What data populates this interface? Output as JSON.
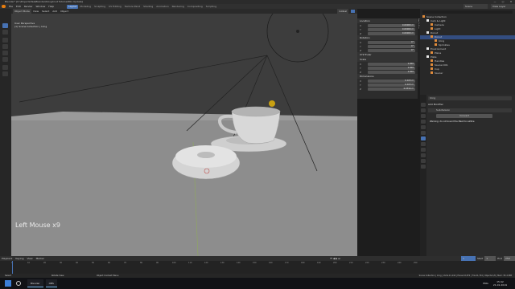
{
  "window": {
    "title": "Blender* [D:\\Projects\\Tea\\Blender\\Doughnut Tutorial\\Mix Update]",
    "controls": [
      "—",
      "▢",
      "✕"
    ]
  },
  "menu": [
    "File",
    "Edit",
    "Render",
    "Window",
    "Help"
  ],
  "workspaces": [
    "Layout",
    "Modeling",
    "Sculpting",
    "UV Editing",
    "Texture Paint",
    "Shading",
    "Animation",
    "Rendering",
    "Compositing",
    "Scripting"
  ],
  "active_workspace": "Layout",
  "top_right": {
    "scene": "Scene",
    "view_layer": "View Layer"
  },
  "viewport_header": {
    "mode": "Object Mode",
    "menus": [
      "View",
      "Select",
      "Add",
      "Object"
    ],
    "shading": "Global"
  },
  "viewport_info": {
    "line1": "User Perspective",
    "line2": "(1) Scene Collection | Icing"
  },
  "overlay": "Left Mouse x9",
  "npanel": {
    "sections": [
      {
        "title": "Location",
        "rows": [
          [
            "X",
            "0.00000 m"
          ],
          [
            "Y",
            "0.00000 m"
          ],
          [
            "Z",
            "0.00000 m"
          ]
        ]
      },
      {
        "title": "Rotation",
        "rows": [
          [
            "X",
            "0°"
          ],
          [
            "Y",
            "0°"
          ],
          [
            "Z",
            "0°"
          ]
        ]
      },
      {
        "title": "XYZ Euler",
        "rows": []
      },
      {
        "title": "Scale",
        "rows": [
          [
            "X",
            "1.000"
          ],
          [
            "Y",
            "1.000"
          ],
          [
            "Z",
            "1.000"
          ]
        ]
      },
      {
        "title": "Dimensions",
        "rows": [
          [
            "X",
            "0.103 m"
          ],
          [
            "Y",
            "0.103 m"
          ],
          [
            "Z",
            "0.0394 m"
          ]
        ]
      }
    ],
    "tabs": [
      "Item",
      "Tool",
      "View"
    ]
  },
  "outliner": {
    "rows": [
      {
        "label": "Scene Collection",
        "indent": 0,
        "selected": false
      },
      {
        "label": "Cam & Light",
        "indent": 1,
        "selected": false
      },
      {
        "label": "Camera",
        "indent": 2,
        "selected": false
      },
      {
        "label": "Light",
        "indent": 2,
        "selected": false
      },
      {
        "label": "Donut",
        "indent": 1,
        "selected": false
      },
      {
        "label": "Donut",
        "indent": 2,
        "selected": true
      },
      {
        "label": "Icing",
        "indent": 3,
        "selected": false
      },
      {
        "label": "Sprinkles",
        "indent": 3,
        "selected": false
      },
      {
        "label": "Environment",
        "indent": 1,
        "selected": false
      },
      {
        "label": "Plane",
        "indent": 2,
        "selected": false
      },
      {
        "label": "Plate",
        "indent": 1,
        "selected": false
      },
      {
        "label": "Handles",
        "indent": 2,
        "selected": false
      },
      {
        "label": "Saucer.001",
        "indent": 2,
        "selected": false
      },
      {
        "label": "Cup",
        "indent": 2,
        "selected": false
      },
      {
        "label": "Saucer",
        "indent": 2,
        "selected": false
      }
    ]
  },
  "properties": {
    "object_name": "Icing",
    "add_modifier": "Add Modifier",
    "modifier_name": "Subdivision",
    "button": "Convert",
    "warning": "Warning: do not bound the Mesh to Lattice"
  },
  "timeline": {
    "menus": [
      "Playback",
      "Keying",
      "View",
      "Marker"
    ],
    "frame": "1",
    "start_label": "Start",
    "start": "1",
    "end_label": "End",
    "end": "250",
    "ticks": [
      "0",
      "10",
      "20",
      "30",
      "40",
      "50",
      "60",
      "70",
      "80",
      "90",
      "100",
      "110",
      "120",
      "130",
      "140",
      "150",
      "160",
      "170",
      "180",
      "190",
      "200",
      "210",
      "220",
      "230",
      "240",
      "250"
    ]
  },
  "statusbar": {
    "left": "Select",
    "mid": "Rotate View",
    "right_hint": "Object Context Menu",
    "stats": "Scene Collection | Icing | Verts:11,244 | Faces:10,872 | Tris:21,744 | Objects:1/6 | Mem: 95.4 MiB"
  },
  "taskbar": {
    "apps": [
      "Blender",
      "OBS"
    ],
    "time": "15:42",
    "date": "21.01.2019",
    "lang": "ENG"
  },
  "colors": {
    "accent": "#4772b3",
    "selected_row": "#334d80",
    "viewport_bg": "#3d3d3d",
    "floor": "#8f8f8f"
  }
}
